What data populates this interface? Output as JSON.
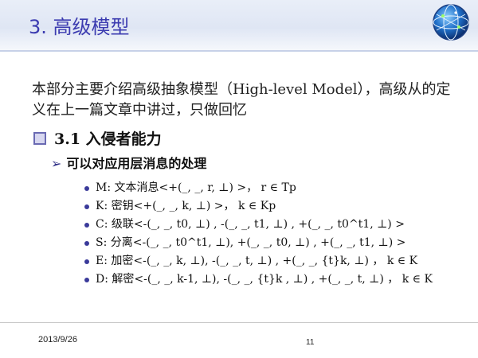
{
  "header": {
    "title": "3. 高级模型"
  },
  "intro": "本部分主要介绍高级抽象模型（High-level Model），高级从的定义在上一篇文章中讲过，只做回忆",
  "section": {
    "title": "3.1 入侵者能力"
  },
  "subsection": {
    "arrow": "➢",
    "title": "可以对应用层消息的处理"
  },
  "items": [
    "M: 文本消息<+(_, _, r, ⊥) >， r ∈ Tp",
    "K: 密钥<+(_, _, k, ⊥) >， k ∈ Kp",
    "C: 级联<-(_, _, t0, ⊥) , -(_, _, t1, ⊥) , +(_, _, t0^t1, ⊥) >",
    "S: 分离<-(_, _, t0^t1, ⊥), +(_, _, t0, ⊥) , +(_, _, t1, ⊥) >",
    "E: 加密<-(_, _, k, ⊥), -(_, _, t, ⊥) , +(_, _, {t}k, ⊥) ， k ∈ K",
    "D: 解密<-(_, _, k-1, ⊥), -(_, _, {t}k , ⊥) , +(_, _, t, ⊥) ， k ∈ K"
  ],
  "footer": {
    "date": "2013/9/26",
    "page": "11"
  }
}
